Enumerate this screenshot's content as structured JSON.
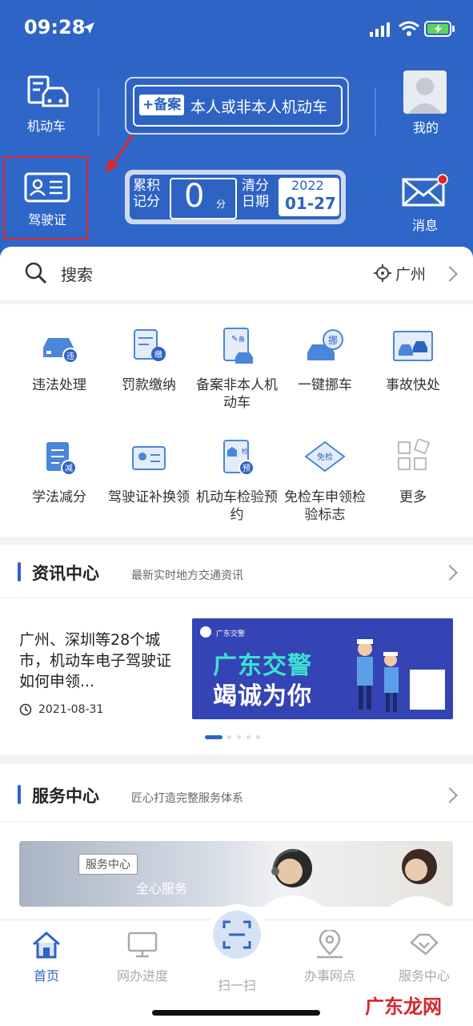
{
  "status": {
    "time": "09:28"
  },
  "header": {
    "vehicle_tile": "机动车",
    "license_tile": "驾驶证",
    "record_tag": "备案",
    "record_text": "本人或非本人机动车",
    "points_label_1": "累积",
    "points_label_2": "记分",
    "points_value": "0",
    "points_unit": "分",
    "clear_label_1": "清分",
    "clear_label_2": "日期",
    "clear_year": "2022",
    "clear_date": "01-27",
    "profile_label": "我的",
    "message_label": "消息"
  },
  "search": {
    "placeholder": "搜索",
    "city": "广州"
  },
  "services": [
    {
      "label": "违法处理"
    },
    {
      "label": "罚款缴纳"
    },
    {
      "label": "备案非本人机动车"
    },
    {
      "label": "一键挪车"
    },
    {
      "label": "事故快处"
    },
    {
      "label": "学法减分"
    },
    {
      "label": "驾驶证补换领"
    },
    {
      "label": "机动车检验预约"
    },
    {
      "label": "免检车申领检验标志"
    },
    {
      "label": "更多"
    }
  ],
  "news": {
    "title": "资讯中心",
    "subtitle": "最新实时地方交通资讯",
    "article_title": "广州、深圳等28个城市，机动车电子驾驶证如何申领...",
    "article_date": "2021-08-31",
    "banner_text_1": "广东交警",
    "banner_text_2": "竭诚为你",
    "banner_brand": "广东交警"
  },
  "service_center": {
    "title": "服务中心",
    "subtitle": "匠心打造完整服务体系",
    "banner_tag": "服务中心",
    "banner_text": "全心服务"
  },
  "tabs": [
    {
      "label": "首页"
    },
    {
      "label": "网办进度"
    },
    {
      "label": "扫一扫"
    },
    {
      "label": "办事网点"
    },
    {
      "label": "服务中心"
    }
  ],
  "watermark": "广东龙网",
  "colors": {
    "brand_blue": "#2e63c4",
    "highlight_red": "#e0262c"
  }
}
